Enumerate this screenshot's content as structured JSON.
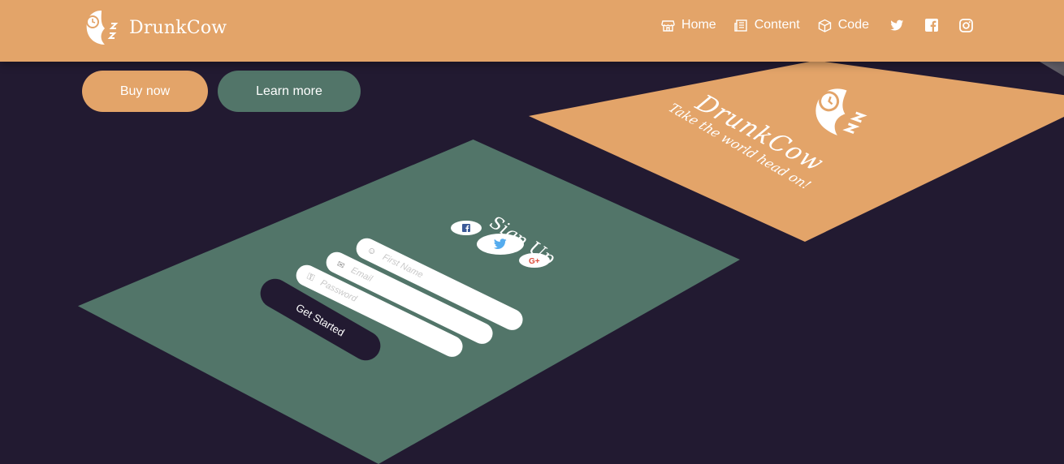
{
  "navbar": {
    "brand_name": "DrunkCow",
    "items": [
      {
        "label": "Home",
        "icon": "store-icon"
      },
      {
        "label": "Content",
        "icon": "newspaper-icon"
      },
      {
        "label": "Code",
        "icon": "box-icon"
      }
    ],
    "social": [
      "twitter-icon",
      "facebook-icon",
      "instagram-icon"
    ]
  },
  "hero": {
    "buy_label": "Buy now",
    "learn_label": "Learn more"
  },
  "signup": {
    "title": "Sign Up",
    "fields": [
      {
        "placeholder": "First Name",
        "icon": "user-icon"
      },
      {
        "placeholder": "Email",
        "icon": "mail-icon"
      },
      {
        "placeholder": "Password",
        "icon": "lock-icon"
      }
    ],
    "cta_label": "Get Started"
  },
  "brand_card": {
    "title": "DrunkCow",
    "tagline": "Take the world head on!"
  },
  "colors": {
    "background": "#221a31",
    "accent": "#e3a469",
    "secondary": "#527569"
  }
}
